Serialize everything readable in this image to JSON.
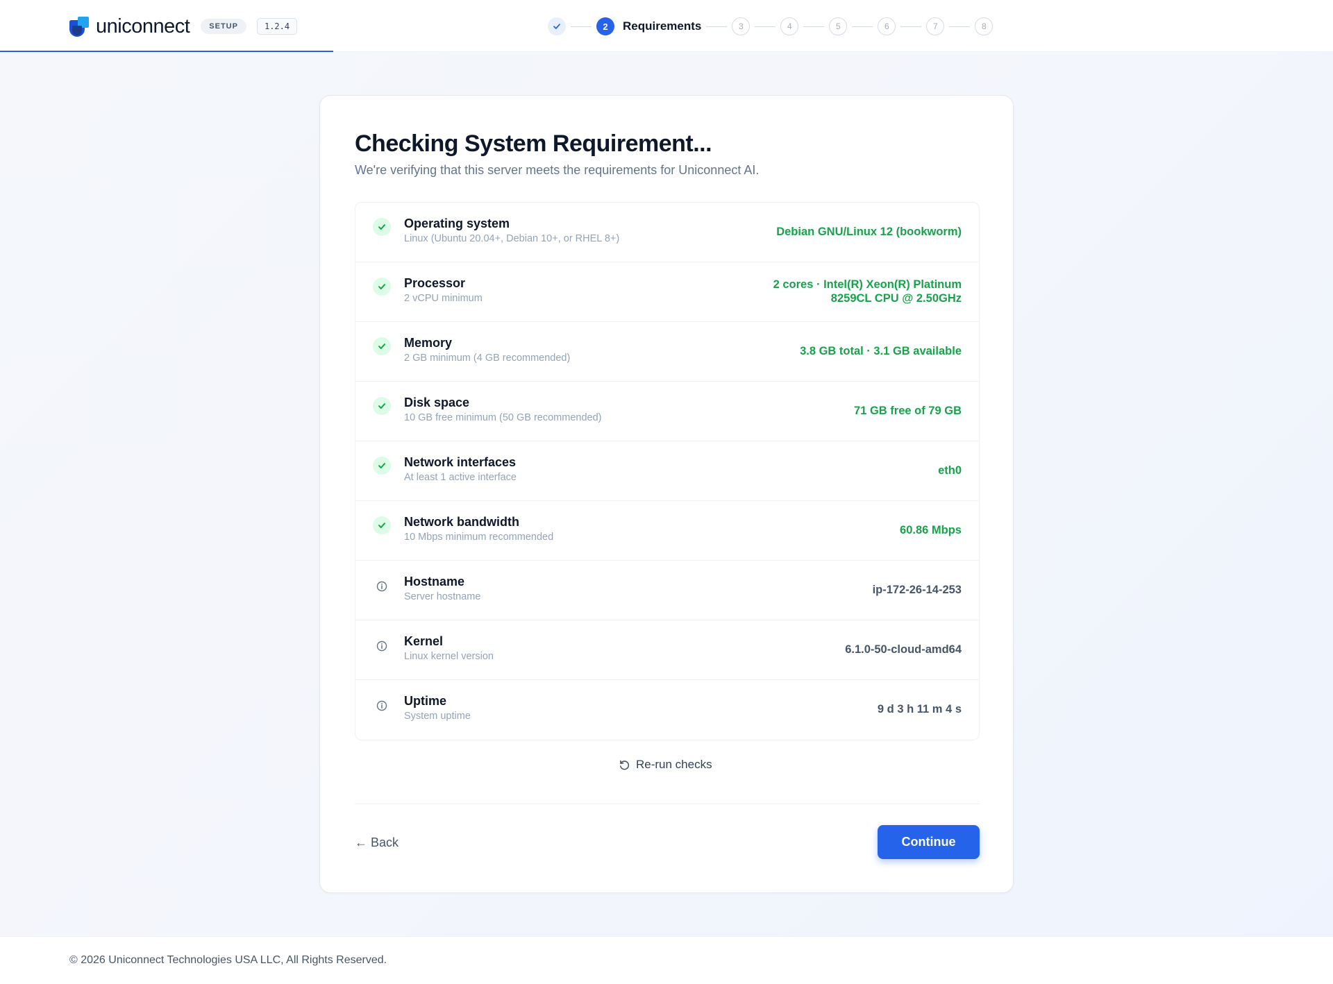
{
  "header": {
    "brand_name": "uniconnect",
    "setup_badge": "SETUP",
    "version": "1.2.4",
    "colors": {
      "accent": "#2563eb",
      "success": "#16a34a"
    },
    "stepper": {
      "completed_icon": "check-icon",
      "active_step_number": "2",
      "active_step_label": "Requirements",
      "pending_steps": [
        "3",
        "4",
        "5",
        "6",
        "7",
        "8"
      ]
    }
  },
  "card": {
    "title": "Checking System Requirement...",
    "subtitle": "We're verifying that this server meets the requirements for Uniconnect AI.",
    "requirements": [
      {
        "name": "Operating system",
        "description": "Linux (Ubuntu 20.04+, Debian 10+, or RHEL 8+)",
        "value": "Debian GNU/Linux 12 (bookworm)",
        "status": "pass",
        "icon": "check-circle-icon"
      },
      {
        "name": "Processor",
        "description": "2 vCPU minimum",
        "value": "2 cores · Intel(R) Xeon(R) Platinum 8259CL CPU @ 2.50GHz",
        "status": "pass",
        "icon": "check-circle-icon"
      },
      {
        "name": "Memory",
        "description": "2 GB minimum (4 GB recommended)",
        "value": "3.8 GB total · 3.1 GB available",
        "status": "pass",
        "icon": "check-circle-icon"
      },
      {
        "name": "Disk space",
        "description": "10 GB free minimum (50 GB recommended)",
        "value": "71 GB free of 79 GB",
        "status": "pass",
        "icon": "check-circle-icon"
      },
      {
        "name": "Network interfaces",
        "description": "At least 1 active interface",
        "value": "eth0",
        "status": "pass",
        "icon": "check-circle-icon"
      },
      {
        "name": "Network bandwidth",
        "description": "10 Mbps minimum recommended",
        "value": "60.86 Mbps",
        "status": "pass",
        "icon": "check-circle-icon"
      },
      {
        "name": "Hostname",
        "description": "Server hostname",
        "value": "ip-172-26-14-253",
        "status": "info",
        "icon": "info-icon"
      },
      {
        "name": "Kernel",
        "description": "Linux kernel version",
        "value": "6.1.0-50-cloud-amd64",
        "status": "info",
        "icon": "info-icon"
      },
      {
        "name": "Uptime",
        "description": "System uptime",
        "value": "9 d 3 h 11 m 4 s",
        "status": "info",
        "icon": "info-icon"
      }
    ],
    "rerun_label": "Re-run checks",
    "back_label": "← Back",
    "continue_label": "Continue"
  },
  "footer": {
    "copyright": "© 2026 Uniconnect Technologies USA LLC, All Rights Reserved."
  }
}
